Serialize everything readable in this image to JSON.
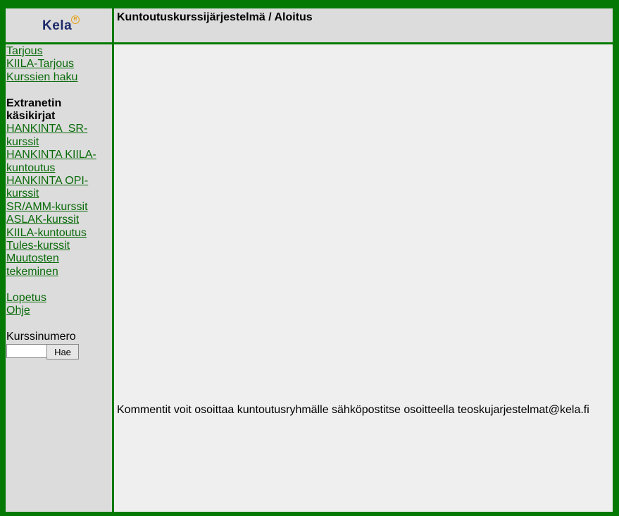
{
  "logo": {
    "text": "Kela",
    "mark": "R"
  },
  "header": {
    "title": "Kuntoutuskurssijärjestelmä / Aloitus"
  },
  "sidebar": {
    "links_top": [
      "Tarjous",
      "KIILA-Tarjous",
      "Kurssien haku"
    ],
    "manuals_heading": [
      "Extranetin",
      "käsikirjat"
    ],
    "manual_links": [
      [
        "HANKINTA  SR-",
        "kurssit"
      ],
      [
        "HANKINTA KIILA-",
        "kuntoutus"
      ],
      [
        "HANKINTA OPI-",
        "kurssit"
      ],
      [
        "SR/AMM-kurssit"
      ],
      [
        "ASLAK-kurssit"
      ],
      [
        "KIILA-kuntoutus"
      ],
      [
        "Tules-kurssit"
      ],
      [
        "Muutosten",
        "tekeminen"
      ]
    ],
    "links_bottom": [
      "Lopetus",
      "Ohje"
    ],
    "course_number_label": "Kurssinumero",
    "course_number_value": "",
    "search_button": "Hae"
  },
  "content": {
    "comment": "Kommentit voit osoittaa kuntoutusryhmälle sähköpostitse osoitteella teoskujarjestelmat@kela.fi"
  },
  "colors": {
    "frame": "#047a04",
    "link": "#0a6b0a",
    "panel": "#dcdcdc",
    "content": "#efefef"
  }
}
